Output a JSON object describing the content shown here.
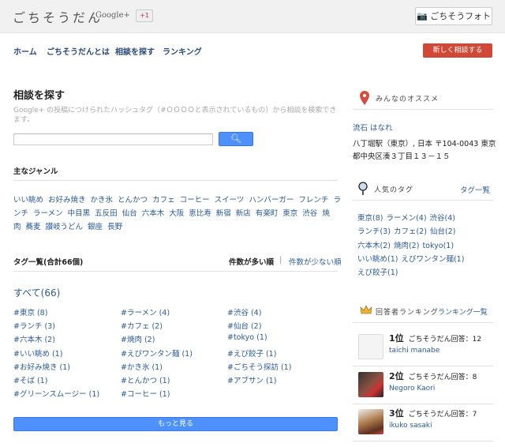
{
  "header": {
    "logo": "ごちそうだん",
    "logo_suffix": "Google+",
    "plusone": "+1",
    "photo_button": "ごちそうフォト"
  },
  "nav": {
    "items": [
      "ホーム",
      "ごちそうだんとは",
      "相談を探す",
      "ランキング"
    ],
    "new_button": "新しく相談する"
  },
  "main": {
    "title": "相談を探す",
    "description": "Google+ の投稿につけられたハッシュタグ（#ＯＯＯＯと表示されているもの）から相談を検索できます。",
    "search": {
      "value": "",
      "placeholder": ""
    },
    "genre_heading": "主なジャンル",
    "genres": [
      "いい眺め",
      "お好み焼き",
      "かき氷",
      "とんかつ",
      "カフェ",
      "コーヒー",
      "スイーツ",
      "ハンバーガー",
      "フレンチ",
      "ランチ",
      "ラーメン",
      "中目黒",
      "五反田",
      "仙台",
      "六本木",
      "大阪",
      "恵比寿",
      "新宿",
      "新店",
      "有楽町",
      "東京",
      "渋谷",
      "焼肉",
      "蕎麦",
      "讃岐うどん",
      "銀座",
      "長野"
    ],
    "tag_list_heading": "タグ一覧(合計66個)",
    "sort_desc": "件数が多い順",
    "sort_sep": "|",
    "sort_asc": "件数が少ない順",
    "all_label": "すべて(66)",
    "tags": [
      "#東京 (8)",
      "#ラーメン (4)",
      "#渋谷 (4)",
      "#ランチ (3)",
      "#カフェ (2)",
      "#仙台 (2)",
      "#六本木 (2)",
      "#焼肉 (2)",
      "#tokyo (1)",
      "#いい眺め (1)",
      "#えびワンタン麺 (1)",
      "#えび餃子 (1)",
      "#お好み焼き (1)",
      "#かき氷 (1)",
      "#ごちそう探訪 (1)",
      "#そば (1)",
      "#とんかつ (1)",
      "#アブサン (1)",
      "#グリーンスムージー (1)",
      "#コーヒー (1)"
    ],
    "more_button": "もっと見る"
  },
  "sidebar": {
    "recommend_heading": "みんなのオススメ",
    "recommend_name": "流石 はなれ",
    "recommend_address_1": "八丁堀駅（東京）, 日本 〒104-0043 東京",
    "recommend_address_2": "都中央区湊３丁目１３－１５",
    "popular_heading": "人気のタグ",
    "popular_link": "タグ一覧",
    "popular_rows": [
      [
        "東京(8)",
        "ラーメン(4)",
        "渋谷(4)"
      ],
      [
        "ランチ(3)",
        "カフェ(2)",
        "仙台(2)"
      ],
      [
        "六本木(2)",
        "焼肉(2)",
        "tokyo(1)"
      ],
      [
        "いい眺め(1)",
        "えびワンタン麺(1)"
      ],
      [
        "えび餃子(1)"
      ]
    ],
    "ranking_heading": "回答者ランキング",
    "ranking_link": "ランキング一覧",
    "ranking": [
      {
        "rank": "1位",
        "count": "ごちそうだん回答：12",
        "name": "taichi manabe"
      },
      {
        "rank": "2位",
        "count": "ごちそうだん回答：8",
        "name": "Negoro Kaori"
      },
      {
        "rank": "3位",
        "count": "ごちそうだん回答：7",
        "name": "ikuko sasaki"
      }
    ]
  },
  "colors": {
    "accent_red": "#d14836",
    "accent_blue": "#4d90fe",
    "link": "#2a5a9a"
  }
}
